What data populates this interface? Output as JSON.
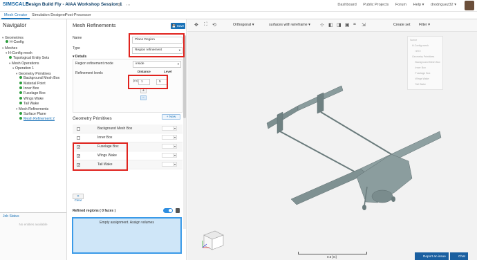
{
  "header": {
    "logo": "SIMSCALE",
    "project_title": "Design Build Fly - AIAA Workshop Session 1",
    "nav": [
      "Dashboard",
      "Public Projects",
      "Forum",
      "Help ▾",
      "drodriguez32 ▾"
    ]
  },
  "tabs": [
    "Mesh Creator",
    "Simulation Designer",
    "Post-Processor"
  ],
  "navigator": {
    "title": "Navigator",
    "tree": [
      {
        "label": "Geometries",
        "indent": 0,
        "caret": "▾",
        "dot": false
      },
      {
        "label": "H-Config",
        "indent": 1,
        "caret": "",
        "dot": true
      },
      {
        "label": "Meshes",
        "indent": 0,
        "caret": "▾",
        "dot": false
      },
      {
        "label": "H-Config mesh",
        "indent": 1,
        "caret": "▾",
        "dot": false
      },
      {
        "label": "Topological Entity Sets",
        "indent": 2,
        "caret": "",
        "dot": true
      },
      {
        "label": "Mesh Operations",
        "indent": 2,
        "caret": "▾",
        "dot": false
      },
      {
        "label": "Operation 1",
        "indent": 3,
        "caret": "▾",
        "dot": false
      },
      {
        "label": "Geometry Primitives",
        "indent": 4,
        "caret": "▾",
        "dot": false
      },
      {
        "label": "Background Mesh Box",
        "indent": 5,
        "caret": "",
        "dot": true
      },
      {
        "label": "Material Point",
        "indent": 5,
        "caret": "",
        "dot": true
      },
      {
        "label": "Inner Box",
        "indent": 5,
        "caret": "",
        "dot": true
      },
      {
        "label": "Fuselage Box",
        "indent": 5,
        "caret": "",
        "dot": true
      },
      {
        "label": "Wings Wake",
        "indent": 5,
        "caret": "",
        "dot": true
      },
      {
        "label": "Tail Wake",
        "indent": 5,
        "caret": "",
        "dot": true
      },
      {
        "label": "Mesh Refinements",
        "indent": 4,
        "caret": "▾",
        "dot": false
      },
      {
        "label": "Surface Plane",
        "indent": 5,
        "caret": "",
        "dot": true
      },
      {
        "label": "Mesh Refinement 2",
        "indent": 5,
        "caret": "",
        "dot": true,
        "link": true
      }
    ],
    "job_status_title": "Job Status",
    "job_status_empty": "No entities available"
  },
  "panel": {
    "title": "Mesh Refinements",
    "save_label": "Save",
    "name_label": "Name",
    "name_value": "Plane Region",
    "type_label": "Type",
    "type_value": "Region refinement",
    "details_label": "Details",
    "mode_label": "Region refinement mode",
    "mode_value": "inside",
    "levels_label": "Refinement levels",
    "distance_header": "Distance",
    "level_header": "Level",
    "unit": "[m]",
    "distance_value": "1",
    "level_value": "5",
    "add_symbol": "+",
    "remove_symbol": "−",
    "geo_title": "Geometry Primitives",
    "new_label": "+ New",
    "geo_rows": [
      {
        "label": "Background Mesh Box",
        "checked": false
      },
      {
        "label": "Inner Box",
        "checked": false
      },
      {
        "label": "Fuselage Box",
        "checked": true
      },
      {
        "label": "Wings Wake",
        "checked": true
      },
      {
        "label": "Tail Wake",
        "checked": true
      }
    ],
    "clear_label": "Clear",
    "refined_label": "Refined regions ( 0 faces )",
    "assign_text": "Empty assignment. Assign volumes"
  },
  "viewer": {
    "toolbar": {
      "projection": "Orthogonal",
      "render_mode": "surfaces with wireframe",
      "create_set": "Create set",
      "filter": "Filter"
    },
    "scene_tree": [
      "Scene",
      "H-Config mesh",
      "refl 0",
      "Geometry Primitives",
      "Background Mesh Box",
      "Inner Box",
      "Fuselage Box",
      "Wings Wake",
      "Tail Wake"
    ],
    "scale_label": "0.5 [m]",
    "report_label": "Report an issue",
    "chat_label": "Chat"
  },
  "colors": {
    "accent": "#1a73b8",
    "highlight": "#e0231e",
    "ok_dot": "#2e9d3e",
    "assign_fill": "#cfe6f8"
  }
}
